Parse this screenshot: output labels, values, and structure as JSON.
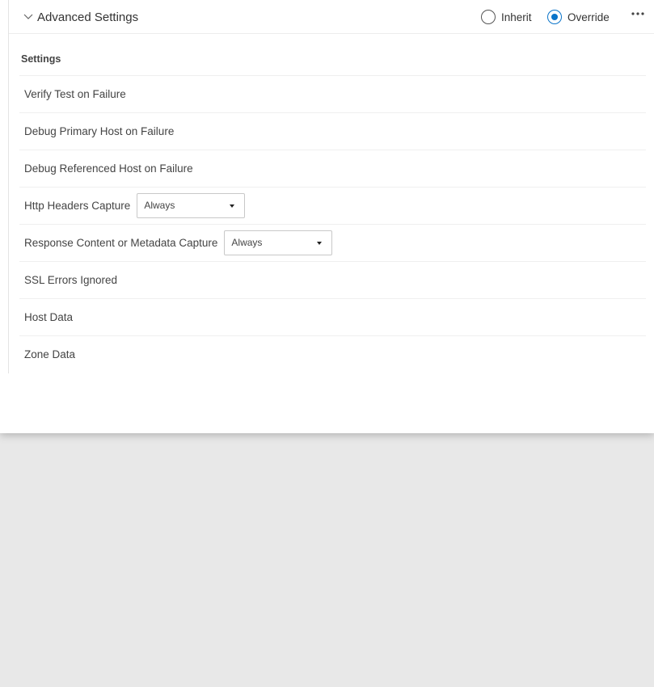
{
  "header": {
    "title": "Advanced Settings",
    "mode_options": [
      {
        "label": "Inherit",
        "selected": false
      },
      {
        "label": "Override",
        "selected": true
      }
    ],
    "more_icon": "more-horizontal-icon",
    "collapse_icon": "chevron-down-icon",
    "accent_color": "#0a74c9"
  },
  "section": {
    "heading": "Settings"
  },
  "rows": [
    {
      "label": "Verify Test on Failure"
    },
    {
      "label": "Debug Primary Host on Failure"
    },
    {
      "label": "Debug Referenced Host on Failure"
    },
    {
      "label": "Http Headers Capture",
      "dropdown_value": "Always"
    },
    {
      "label": "Response Content or Metadata Capture",
      "dropdown_value": "Always"
    },
    {
      "label": "SSL Errors Ignored"
    },
    {
      "label": "Host Data"
    },
    {
      "label": "Zone Data"
    }
  ]
}
